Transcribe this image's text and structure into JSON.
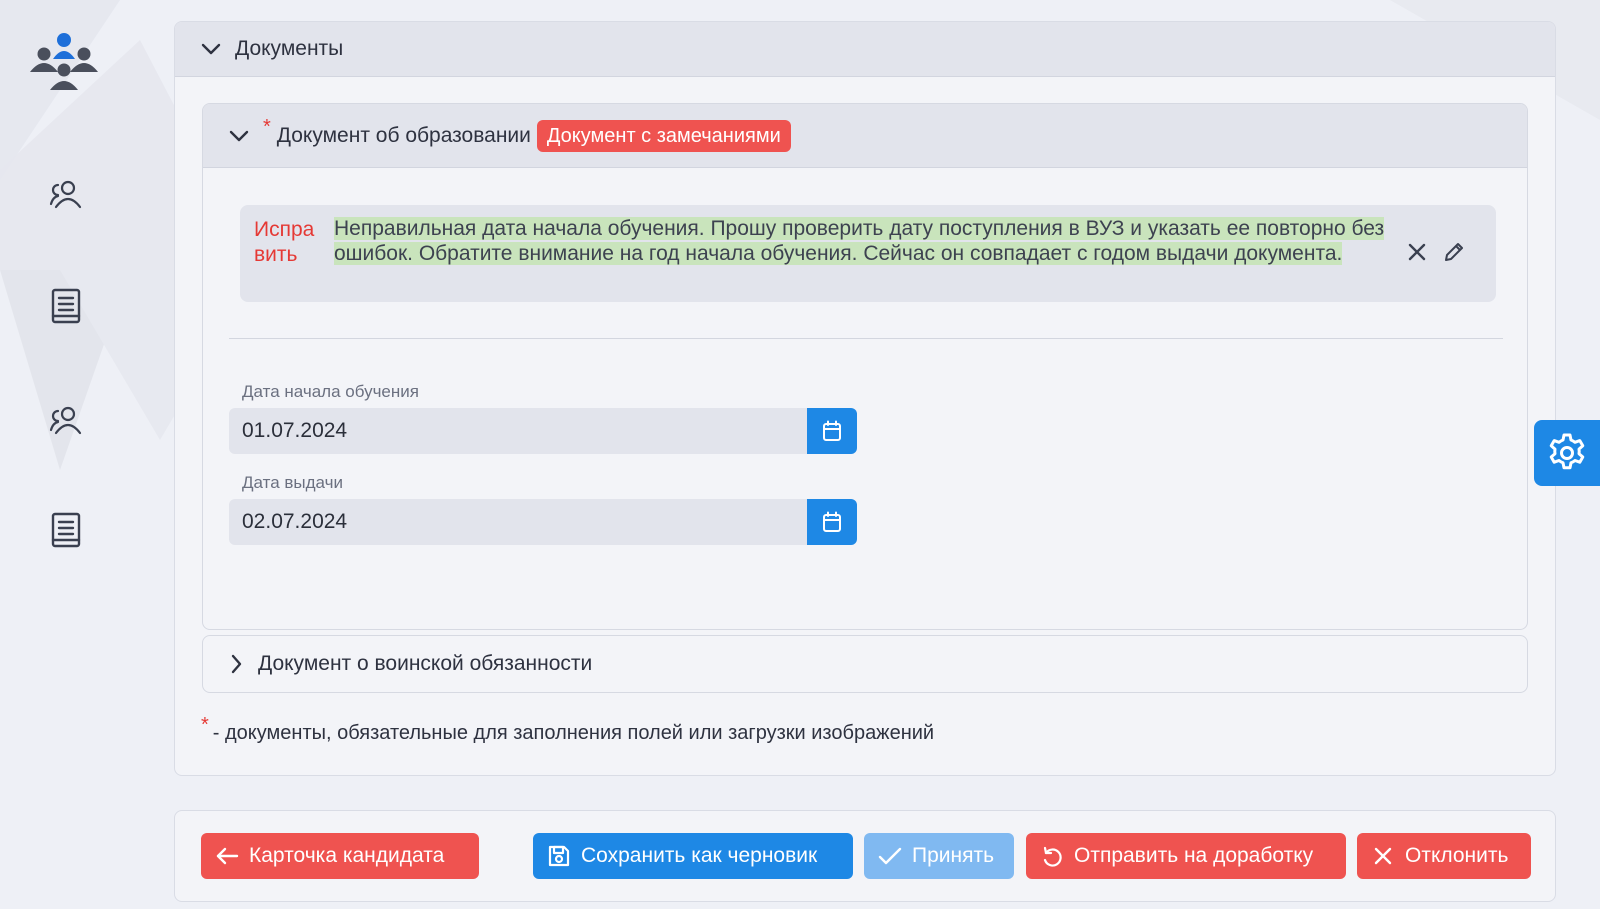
{
  "app": {
    "logo_icon": "people-group-icon",
    "accent": "#1e88e5",
    "danger": "#ef5350"
  },
  "sidebar": {
    "items": [
      {
        "icon": "users-icon"
      },
      {
        "icon": "document-list-icon"
      },
      {
        "icon": "users-icon"
      },
      {
        "icon": "document-list-icon"
      }
    ]
  },
  "documents": {
    "title": "Документы",
    "education": {
      "required_mark": "*",
      "title": "Документ об образовании",
      "status": "Документ с замечаниями",
      "remark": {
        "kind": "Исправить",
        "text": "Неправильная дата начала обучения. Прошу проверить дату поступления в ВУЗ и указать ее повторно без ошибок. Обратите внимание на год начала обучения. Сейчас он совпадает с годом выдачи документа."
      },
      "fields": [
        {
          "label": "Дата начала обучения",
          "value": "01.07.2024"
        },
        {
          "label": "Дата выдачи",
          "value": "02.07.2024"
        }
      ]
    },
    "military": {
      "title": "Документ о воинской обязанности"
    },
    "footnote": {
      "mark": "*",
      "text": "- документы, обязательные для заполнения полей или загрузки изображений"
    }
  },
  "actions": {
    "back": "Карточка кандидата",
    "save_draft": "Сохранить как черновик",
    "accept": "Принять",
    "send_back": "Отправить на доработку",
    "reject": "Отклонить"
  }
}
